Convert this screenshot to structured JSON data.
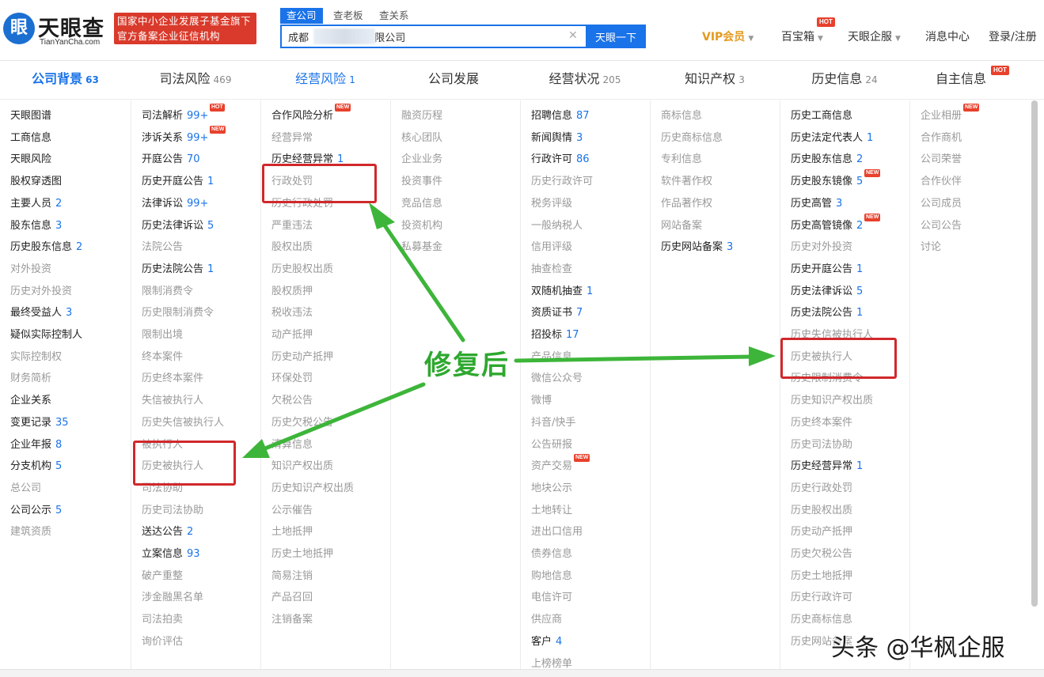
{
  "header": {
    "logo_mark": "眼",
    "logo_text": "天眼查",
    "logo_sub": "TianYanCha.com",
    "gov_line1": "国家中小企业发展子基金旗下",
    "gov_line2": "官方备案企业征信机构",
    "search_tabs": [
      "查公司",
      "查老板",
      "查关系"
    ],
    "search_value": "成都                 有限公司",
    "search_button": "天眼一下",
    "nav": [
      {
        "label": "VIP会员",
        "caret": "▼"
      },
      {
        "label": "百宝箱",
        "caret": "▼",
        "badge": "HOT"
      },
      {
        "label": "天眼企服",
        "caret": "▼"
      },
      {
        "label": "消息中心"
      },
      {
        "label": "登录/注册"
      }
    ]
  },
  "categories": [
    {
      "label": "公司背景",
      "count": "63"
    },
    {
      "label": "司法风险",
      "count": "469"
    },
    {
      "label": "经营风险",
      "count": "1"
    },
    {
      "label": "公司发展",
      "count": ""
    },
    {
      "label": "经营状况",
      "count": "205"
    },
    {
      "label": "知识产权",
      "count": "3"
    },
    {
      "label": "历史信息",
      "count": "24"
    },
    {
      "label": "自主信息",
      "count": "",
      "badge": "HOT"
    }
  ],
  "columns": [
    [
      {
        "t": "天眼图谱",
        "c": "",
        "on": true
      },
      {
        "t": "工商信息",
        "c": "",
        "on": true
      },
      {
        "t": "天眼风险",
        "c": "",
        "on": true
      },
      {
        "t": "股权穿透图",
        "c": "",
        "on": true
      },
      {
        "t": "主要人员",
        "c": "2",
        "on": true
      },
      {
        "t": "股东信息",
        "c": "3",
        "on": true
      },
      {
        "t": "历史股东信息",
        "c": "2",
        "on": true
      },
      {
        "t": "对外投资",
        "c": "",
        "on": false
      },
      {
        "t": "历史对外投资",
        "c": "",
        "on": false
      },
      {
        "t": "最终受益人",
        "c": "3",
        "on": true
      },
      {
        "t": "疑似实际控制人",
        "c": "",
        "on": true
      },
      {
        "t": "实际控制权",
        "c": "",
        "on": false
      },
      {
        "t": "财务简析",
        "c": "",
        "on": false
      },
      {
        "t": "企业关系",
        "c": "",
        "on": true
      },
      {
        "t": "变更记录",
        "c": "35",
        "on": true
      },
      {
        "t": "企业年报",
        "c": "8",
        "on": true
      },
      {
        "t": "分支机构",
        "c": "5",
        "on": true
      },
      {
        "t": "总公司",
        "c": "",
        "on": false
      },
      {
        "t": "公司公示",
        "c": "5",
        "on": true
      },
      {
        "t": "建筑资质",
        "c": "",
        "on": false
      }
    ],
    [
      {
        "t": "司法解析",
        "c": "99+",
        "on": true,
        "badge": "HOT"
      },
      {
        "t": "涉诉关系",
        "c": "99+",
        "on": true,
        "badge": "NEW"
      },
      {
        "t": "开庭公告",
        "c": "70",
        "on": true
      },
      {
        "t": "历史开庭公告",
        "c": "1",
        "on": true
      },
      {
        "t": "法律诉讼",
        "c": "99+",
        "on": true
      },
      {
        "t": "历史法律诉讼",
        "c": "5",
        "on": true
      },
      {
        "t": "法院公告",
        "c": "",
        "on": false
      },
      {
        "t": "历史法院公告",
        "c": "1",
        "on": true
      },
      {
        "t": "限制消费令",
        "c": "",
        "on": false
      },
      {
        "t": "历史限制消费令",
        "c": "",
        "on": false
      },
      {
        "t": "限制出境",
        "c": "",
        "on": false
      },
      {
        "t": "终本案件",
        "c": "",
        "on": false
      },
      {
        "t": "历史终本案件",
        "c": "",
        "on": false
      },
      {
        "t": "失信被执行人",
        "c": "",
        "on": false
      },
      {
        "t": "历史失信被执行人",
        "c": "",
        "on": false
      },
      {
        "t": "被执行人",
        "c": "",
        "on": false
      },
      {
        "t": "历史被执行人",
        "c": "",
        "on": false
      },
      {
        "t": "司法协助",
        "c": "",
        "on": false
      },
      {
        "t": "历史司法协助",
        "c": "",
        "on": false
      },
      {
        "t": "送达公告",
        "c": "2",
        "on": true
      },
      {
        "t": "立案信息",
        "c": "93",
        "on": true
      },
      {
        "t": "破产重整",
        "c": "",
        "on": false
      },
      {
        "t": "涉金融黑名单",
        "c": "",
        "on": false
      },
      {
        "t": "司法拍卖",
        "c": "",
        "on": false
      },
      {
        "t": "询价评估",
        "c": "",
        "on": false
      }
    ],
    [
      {
        "t": "合作风险分析",
        "c": "",
        "on": true,
        "badge": "NEW"
      },
      {
        "t": "经营异常",
        "c": "",
        "on": false
      },
      {
        "t": "历史经营异常",
        "c": "1",
        "on": true
      },
      {
        "t": "行政处罚",
        "c": "",
        "on": false
      },
      {
        "t": "历史行政处罚",
        "c": "",
        "on": false
      },
      {
        "t": "严重违法",
        "c": "",
        "on": false
      },
      {
        "t": "股权出质",
        "c": "",
        "on": false
      },
      {
        "t": "历史股权出质",
        "c": "",
        "on": false
      },
      {
        "t": "股权质押",
        "c": "",
        "on": false
      },
      {
        "t": "税收违法",
        "c": "",
        "on": false
      },
      {
        "t": "动产抵押",
        "c": "",
        "on": false
      },
      {
        "t": "历史动产抵押",
        "c": "",
        "on": false
      },
      {
        "t": "环保处罚",
        "c": "",
        "on": false
      },
      {
        "t": "欠税公告",
        "c": "",
        "on": false
      },
      {
        "t": "历史欠税公告",
        "c": "",
        "on": false
      },
      {
        "t": "清算信息",
        "c": "",
        "on": false
      },
      {
        "t": "知识产权出质",
        "c": "",
        "on": false
      },
      {
        "t": "历史知识产权出质",
        "c": "",
        "on": false
      },
      {
        "t": "公示催告",
        "c": "",
        "on": false
      },
      {
        "t": "土地抵押",
        "c": "",
        "on": false
      },
      {
        "t": "历史土地抵押",
        "c": "",
        "on": false
      },
      {
        "t": "简易注销",
        "c": "",
        "on": false
      },
      {
        "t": "产品召回",
        "c": "",
        "on": false
      },
      {
        "t": "注销备案",
        "c": "",
        "on": false
      }
    ],
    [
      {
        "t": "融资历程",
        "c": "",
        "on": false
      },
      {
        "t": "核心团队",
        "c": "",
        "on": false
      },
      {
        "t": "企业业务",
        "c": "",
        "on": false
      },
      {
        "t": "投资事件",
        "c": "",
        "on": false
      },
      {
        "t": "竞品信息",
        "c": "",
        "on": false
      },
      {
        "t": "投资机构",
        "c": "",
        "on": false
      },
      {
        "t": "私募基金",
        "c": "",
        "on": false
      }
    ],
    [
      {
        "t": "招聘信息",
        "c": "87",
        "on": true
      },
      {
        "t": "新闻舆情",
        "c": "3",
        "on": true
      },
      {
        "t": "行政许可",
        "c": "86",
        "on": true
      },
      {
        "t": "历史行政许可",
        "c": "",
        "on": false
      },
      {
        "t": "税务评级",
        "c": "",
        "on": false
      },
      {
        "t": "一般纳税人",
        "c": "",
        "on": false
      },
      {
        "t": "信用评级",
        "c": "",
        "on": false
      },
      {
        "t": "抽查检查",
        "c": "",
        "on": false
      },
      {
        "t": "双随机抽查",
        "c": "1",
        "on": true
      },
      {
        "t": "资质证书",
        "c": "7",
        "on": true
      },
      {
        "t": "招投标",
        "c": "17",
        "on": true
      },
      {
        "t": "产品信息",
        "c": "",
        "on": false
      },
      {
        "t": "微信公众号",
        "c": "",
        "on": false
      },
      {
        "t": "微博",
        "c": "",
        "on": false
      },
      {
        "t": "抖音/快手",
        "c": "",
        "on": false
      },
      {
        "t": "公告研报",
        "c": "",
        "on": false
      },
      {
        "t": "资产交易",
        "c": "",
        "on": false,
        "badge": "NEW"
      },
      {
        "t": "地块公示",
        "c": "",
        "on": false
      },
      {
        "t": "土地转让",
        "c": "",
        "on": false
      },
      {
        "t": "进出口信用",
        "c": "",
        "on": false
      },
      {
        "t": "债券信息",
        "c": "",
        "on": false
      },
      {
        "t": "购地信息",
        "c": "",
        "on": false
      },
      {
        "t": "电信许可",
        "c": "",
        "on": false
      },
      {
        "t": "供应商",
        "c": "",
        "on": false
      },
      {
        "t": "客户",
        "c": "4",
        "on": true
      },
      {
        "t": "上榜榜单",
        "c": "",
        "on": false
      }
    ],
    [
      {
        "t": "商标信息",
        "c": "",
        "on": false
      },
      {
        "t": "历史商标信息",
        "c": "",
        "on": false
      },
      {
        "t": "专利信息",
        "c": "",
        "on": false
      },
      {
        "t": "软件著作权",
        "c": "",
        "on": false
      },
      {
        "t": "作品著作权",
        "c": "",
        "on": false
      },
      {
        "t": "网站备案",
        "c": "",
        "on": false
      },
      {
        "t": "历史网站备案",
        "c": "3",
        "on": true
      }
    ],
    [
      {
        "t": "历史工商信息",
        "c": "",
        "on": true
      },
      {
        "t": "历史法定代表人",
        "c": "1",
        "on": true
      },
      {
        "t": "历史股东信息",
        "c": "2",
        "on": true
      },
      {
        "t": "历史股东镜像",
        "c": "5",
        "on": true,
        "badge": "NEW"
      },
      {
        "t": "历史高管",
        "c": "3",
        "on": true
      },
      {
        "t": "历史高管镜像",
        "c": "2",
        "on": true,
        "badge": "NEW"
      },
      {
        "t": "历史对外投资",
        "c": "",
        "on": false
      },
      {
        "t": "历史开庭公告",
        "c": "1",
        "on": true
      },
      {
        "t": "历史法律诉讼",
        "c": "5",
        "on": true
      },
      {
        "t": "历史法院公告",
        "c": "1",
        "on": true
      },
      {
        "t": "历史失信被执行人",
        "c": "",
        "on": false
      },
      {
        "t": "历史被执行人",
        "c": "",
        "on": false
      },
      {
        "t": "历史限制消费令",
        "c": "",
        "on": false
      },
      {
        "t": "历史知识产权出质",
        "c": "",
        "on": false
      },
      {
        "t": "历史终本案件",
        "c": "",
        "on": false
      },
      {
        "t": "历史司法协助",
        "c": "",
        "on": false
      },
      {
        "t": "历史经营异常",
        "c": "1",
        "on": true
      },
      {
        "t": "历史行政处罚",
        "c": "",
        "on": false
      },
      {
        "t": "历史股权出质",
        "c": "",
        "on": false
      },
      {
        "t": "历史动产抵押",
        "c": "",
        "on": false
      },
      {
        "t": "历史欠税公告",
        "c": "",
        "on": false
      },
      {
        "t": "历史土地抵押",
        "c": "",
        "on": false
      },
      {
        "t": "历史行政许可",
        "c": "",
        "on": false
      },
      {
        "t": "历史商标信息",
        "c": "",
        "on": false
      },
      {
        "t": "历史网站备案",
        "c": "",
        "on": false
      }
    ],
    [
      {
        "t": "企业相册",
        "c": "",
        "on": false,
        "badge": "NEW"
      },
      {
        "t": "合作商机",
        "c": "",
        "on": false
      },
      {
        "t": "公司荣誉",
        "c": "",
        "on": false
      },
      {
        "t": "合作伙伴",
        "c": "",
        "on": false
      },
      {
        "t": "公司成员",
        "c": "",
        "on": false
      },
      {
        "t": "公司公告",
        "c": "",
        "on": false
      },
      {
        "t": "讨论",
        "c": "",
        "on": false
      }
    ]
  ],
  "annotation": {
    "label": "修复后",
    "arrow_color": "#3db53a",
    "box_color": "#d0282b"
  },
  "watermark": "头条 @华枫企服",
  "colors": {
    "brand_blue": "#1a73e8",
    "badge_red": "#e8412c",
    "gov_red": "#d93a2b",
    "vip_gold": "#e49a1e"
  }
}
